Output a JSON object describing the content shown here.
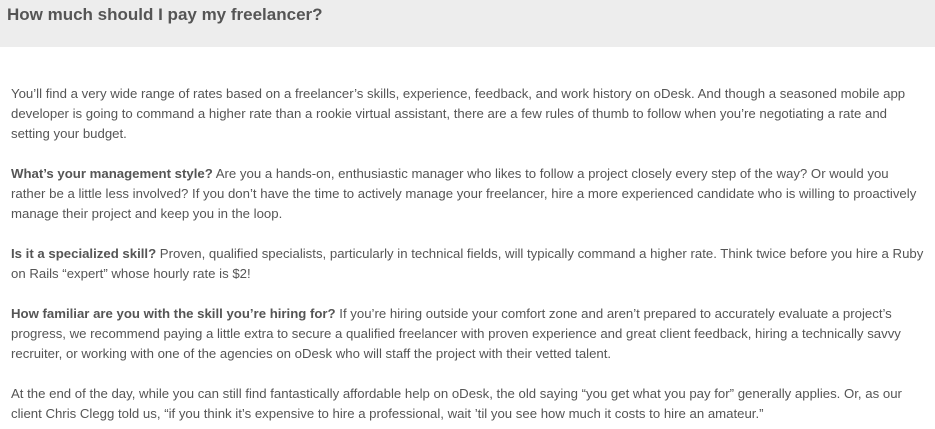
{
  "page": {
    "title": "How much should I pay my freelancer?"
  },
  "article": {
    "intro": "You’ll find a very wide range of rates based on a freelancer’s skills, experience, feedback, and work history on oDesk. And though a seasoned mobile app developer is going to command a higher rate than a rookie virtual assistant, there are a few rules of thumb to follow when you’re negotiating a rate and setting your budget.",
    "sections": [
      {
        "heading": "What’s your management style?",
        "body": " Are you a hands-on, enthusiastic manager who likes to follow a project closely every step of the way? Or would you rather be a little less involved? If you don’t have the time to actively manage your freelancer, hire a more experienced candidate who is willing to proactively manage their project and keep you in the loop."
      },
      {
        "heading": "Is it a specialized skill?",
        "body": " Proven, qualified specialists, particularly in technical fields, will typically command a higher rate. Think twice before you hire a Ruby on Rails “expert” whose hourly rate is $2!"
      },
      {
        "heading": "How familiar are you with the skill you’re hiring for?",
        "body": " If you’re hiring outside your comfort zone and aren’t prepared to accurately evaluate a project’s progress, we recommend paying a little extra to secure a qualified freelancer with proven experience and great client feedback, hiring a technically savvy recruiter, or working with one of the agencies on oDesk who will staff the project with their vetted talent."
      }
    ],
    "conclusion": "At the end of the day, while you can still find fantastically affordable help on oDesk, the old saying “you get what you pay for” generally applies. Or, as our client Chris Clegg told us, “if you think it’s expensive to hire a professional, wait ’til you see how much it costs to hire an amateur.”"
  }
}
